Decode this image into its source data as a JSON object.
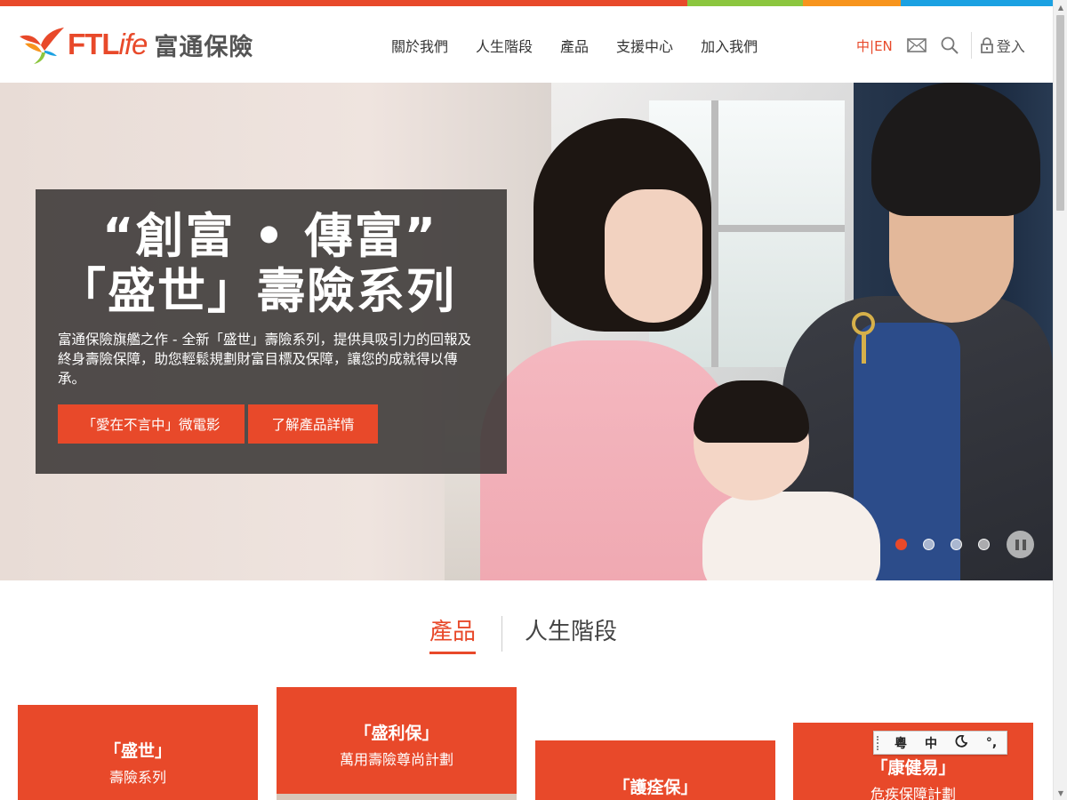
{
  "brand": {
    "logo_latin_ft": "FTL",
    "logo_latin_life": "ife",
    "logo_chinese": "富通保險",
    "strip_colors": [
      "#e8492a",
      "#e8492a",
      "#8cc63f",
      "#f7941d",
      "#1ba1e2"
    ]
  },
  "nav": {
    "items": [
      "關於我們",
      "人生階段",
      "產品",
      "支援中心",
      "加入我們"
    ]
  },
  "utility": {
    "lang_cn": "中",
    "lang_sep": "|",
    "lang_en": "EN",
    "mail_icon": "mail-icon",
    "search_icon": "search-icon",
    "lock_icon": "lock-icon",
    "login_label": "登入"
  },
  "hero": {
    "title_line1": "“創富 • 傳富”",
    "title_line2": "「盛世」壽險系列",
    "description": "富通保險旗艦之作 - 全新「盛世」壽險系列，提供具吸引力的回報及終身壽險保障，助您輕鬆規劃財富目標及保障，讓您的成就得以傳承。",
    "button_video": "「愛在不言中」微電影",
    "button_details": "了解產品詳情",
    "slide_count": 4,
    "active_slide": 1,
    "pause_icon": "pause-icon"
  },
  "sections": {
    "tab_products": "產品",
    "tab_life_stages": "人生階段"
  },
  "products": [
    {
      "name": "「盛世」",
      "sub": "壽險系列"
    },
    {
      "name": "「盛利保」",
      "sub": "萬用壽險尊尚計劃"
    },
    {
      "name": "「護痊保」",
      "sub": ""
    },
    {
      "name": "「康健易」",
      "sub": "危疾保障計劃"
    }
  ],
  "ime_toolbar": {
    "cantonese": "粵",
    "chinese": "中",
    "moon_icon": "moon-icon",
    "punct": "°,"
  }
}
